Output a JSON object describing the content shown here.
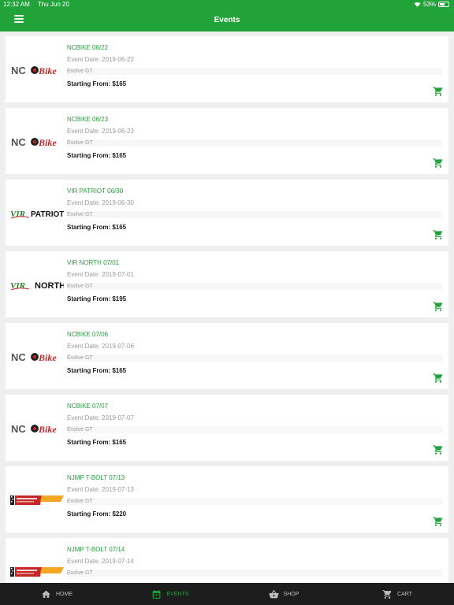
{
  "status_bar": {
    "time": "12:32 AM",
    "date": "Thu Jun 20",
    "battery": "53%"
  },
  "header": {
    "title": "Events"
  },
  "events": [
    {
      "logo": "ncbike-logo",
      "title": "NCBIKE 06/22",
      "date": "Event Date: 2019-06-22",
      "org": "Evolve GT",
      "price": "Starting From: $165"
    },
    {
      "logo": "ncbike-logo",
      "title": "NCBIKE 06/23",
      "date": "Event Date: 2019-06-23",
      "org": "Evolve GT",
      "price": "Starting From: $165"
    },
    {
      "logo": "vir-patriot-logo",
      "title": "VIR PATRIOT 06/30",
      "date": "Event Date: 2019-06-30",
      "org": "Evolve GT",
      "price": "Starting From: $165"
    },
    {
      "logo": "vir-north-logo",
      "title": "VIR NORTH 07/01",
      "date": "Event Date: 2019-07-01",
      "org": "Evolve GT",
      "price": "Starting From: $195"
    },
    {
      "logo": "ncbike-logo",
      "title": "NCBIKE 07/06",
      "date": "Event Date: 2019-07-06",
      "org": "Evolve GT",
      "price": "Starting From: $165"
    },
    {
      "logo": "ncbike-logo",
      "title": "NCBIKE 07/07",
      "date": "Event Date: 2019-07-07",
      "org": "Evolve GT",
      "price": "Starting From: $165"
    },
    {
      "logo": "njmp-tbolt-logo",
      "title": "NJMP T-BOLT 07/13",
      "date": "Event Date: 2019-07-13",
      "org": "Evolve GT",
      "price": "Starting From: $220"
    },
    {
      "logo": "njmp-tbolt-logo",
      "title": "NJMP T-BOLT 07/14",
      "date": "Event Date: 2019-07-14",
      "org": "Evolve GT",
      "price": ""
    }
  ],
  "logos": {
    "ncbike": {
      "left": "NC",
      "right": "Bike"
    },
    "vir_patriot": {
      "mark": "VIR",
      "word": "PATRIOT"
    },
    "vir_north": {
      "mark": "VIR",
      "word": "NORTH"
    }
  },
  "tabs": [
    {
      "label": "HOME",
      "icon": "home-icon"
    },
    {
      "label": "EVENTS",
      "icon": "calendar-icon"
    },
    {
      "label": "SHOP",
      "icon": "basket-icon"
    },
    {
      "label": "CART",
      "icon": "cart-icon"
    }
  ],
  "colors": {
    "accent": "#21a33a",
    "tabbar": "#1d1d1d"
  }
}
